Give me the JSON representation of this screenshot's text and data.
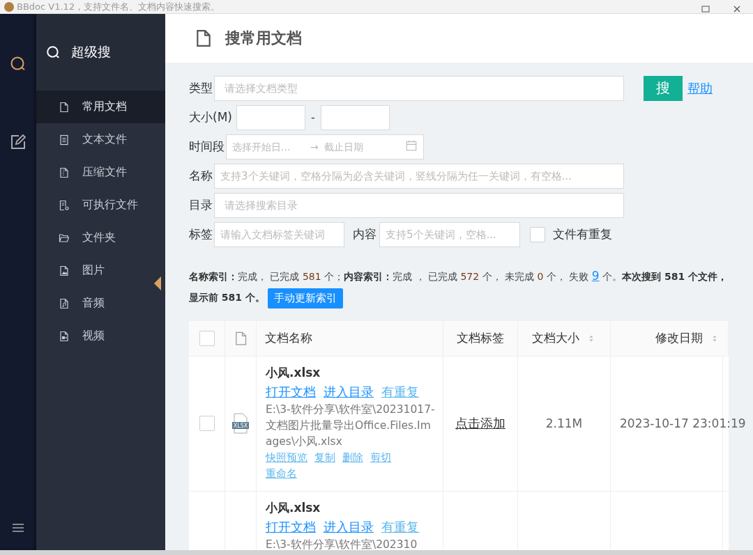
{
  "window": {
    "title": "BBdoc V1.12，支持文件名、文档内容快速搜索。"
  },
  "sidebar": {
    "title": "超级搜",
    "items": [
      {
        "label": "常用文档",
        "selected": true
      },
      {
        "label": "文本文件",
        "selected": false
      },
      {
        "label": "压缩文件",
        "selected": false
      },
      {
        "label": "可执行文件",
        "selected": false
      },
      {
        "label": "文件夹",
        "selected": false
      },
      {
        "label": "图片",
        "selected": false
      },
      {
        "label": "音频",
        "selected": false
      },
      {
        "label": "视频",
        "selected": false
      }
    ]
  },
  "header": {
    "title": "搜常用文档"
  },
  "form": {
    "type": {
      "label": "类型",
      "placeholder": "请选择文档类型"
    },
    "search_button": "搜",
    "help_link": "帮助",
    "size": {
      "label": "大小(M)",
      "separator": "-"
    },
    "period": {
      "label": "时间段",
      "start_placeholder": "选择开始日...",
      "arrow": "→",
      "end_placeholder": "截止日期"
    },
    "name": {
      "label": "名称",
      "placeholder": "支持3个关键词，空格分隔为必含关键词，竖线分隔为任一关键词，有空格..."
    },
    "directory": {
      "label": "目录",
      "placeholder": "请选择搜索目录"
    },
    "tag": {
      "label": "标签",
      "placeholder": "请输入文档标签关键词"
    },
    "content": {
      "label": "内容",
      "placeholder": "支持5个关键词，空格..."
    },
    "duplicates": {
      "label": "文件有重复",
      "checked": false
    }
  },
  "status": {
    "segments": [
      {
        "kind": "bold",
        "text": "名称索引："
      },
      {
        "kind": "plain",
        "text": "完成，  已完成 "
      },
      {
        "kind": "number",
        "text": "581"
      },
      {
        "kind": "plain",
        "text": " 个；"
      },
      {
        "kind": "bold",
        "text": "内容索引："
      },
      {
        "kind": "plain",
        "text": "完成 ，  已完成 "
      },
      {
        "kind": "number",
        "text": "572"
      },
      {
        "kind": "plain",
        "text": " 个，  未完成 "
      },
      {
        "kind": "number",
        "text": "0"
      },
      {
        "kind": "plain",
        "text": " 个，  失败 "
      },
      {
        "kind": "link",
        "text": "9"
      },
      {
        "kind": "plain",
        "text": " 个。"
      },
      {
        "kind": "bold",
        "text": "本次搜到 581 个文件，显示前 581 个。"
      }
    ],
    "update_button": "手动更新索引"
  },
  "table": {
    "columns": [
      "文档名称",
      "文档标签",
      "文档大小",
      "修改日期"
    ],
    "header_checked": false,
    "rows": [
      {
        "checked": false,
        "icon_label": "XLSX",
        "name": "小风.xlsx",
        "links": [
          "打开文档",
          "进入目录",
          "有重复"
        ],
        "path": "E:\\3-软件分享\\软件室\\20231017-文档图片批量导出Office.Files.Images\\小风.xlsx",
        "actions": [
          "快照预览",
          "复制",
          "删除",
          "剪切",
          "重命名"
        ],
        "tag": "点击添加",
        "size": "2.11M",
        "modified": "2023-10-17 23:01:19"
      },
      {
        "name": "小风.xlsx",
        "links": [
          "打开文档",
          "进入目录",
          "有重复"
        ],
        "path": "E:\\3-软件分享\\软件室\\202310"
      }
    ]
  }
}
